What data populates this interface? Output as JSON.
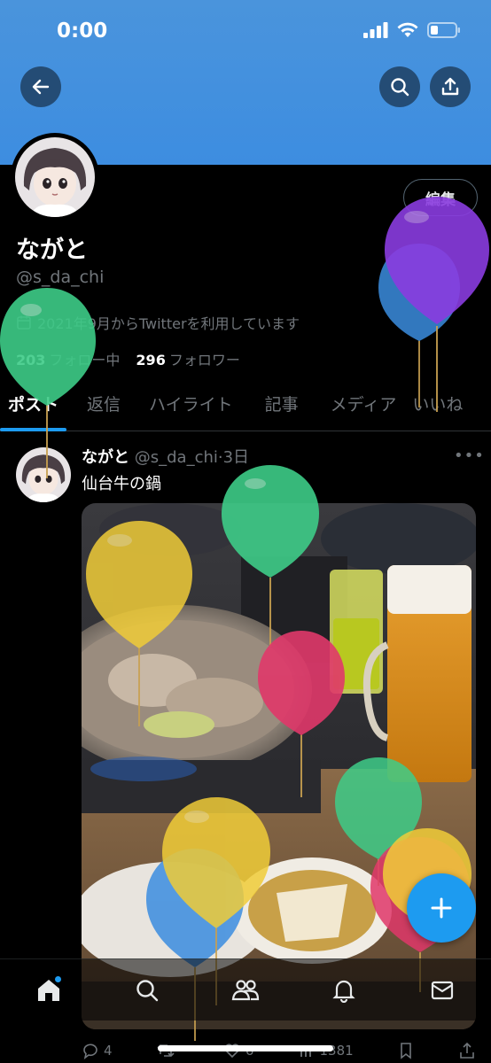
{
  "status": {
    "time": "0:00"
  },
  "profile": {
    "display_name": "ながと",
    "handle": "@s_da_chi",
    "joined": "2021年9月からTwitterを利用しています",
    "following_count": "203",
    "following_label": "フォロー中",
    "followers_count": "296",
    "followers_label": "フォロワー",
    "edit_label": "編集"
  },
  "tabs": [
    {
      "label": "ポスト",
      "active": true
    },
    {
      "label": "返信"
    },
    {
      "label": "ハイライト"
    },
    {
      "label": "記事"
    },
    {
      "label": "メディア"
    },
    {
      "label": "いいね"
    }
  ],
  "post": {
    "author": "ながと",
    "handle": "@s_da_chi",
    "time": "3日",
    "separator": "·",
    "text": "仙台牛の鍋",
    "replies": "4",
    "reposts": "",
    "likes": "6",
    "views": "1381"
  },
  "icons": {
    "back": "arrow-left-icon",
    "search": "search-icon",
    "share": "share-icon",
    "home": "home-icon",
    "explore": "search-icon",
    "communities": "people-icon",
    "notifications": "bell-icon",
    "messages": "mail-icon",
    "compose": "plus-icon"
  },
  "colors": {
    "banner": "#3d8de0",
    "accent": "#1d9bf0",
    "background": "#000000"
  }
}
